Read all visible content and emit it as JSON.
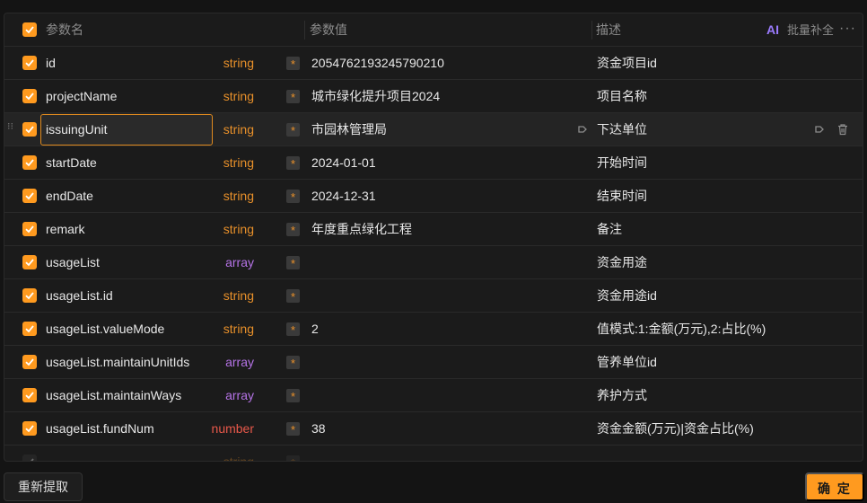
{
  "header": {
    "name_col": "参数名",
    "value_col": "参数值",
    "desc_col": "描述",
    "ai_label": "AI",
    "batch_label": "批量补全",
    "more_label": "···"
  },
  "rows": [
    {
      "name": "id",
      "type": "string",
      "required": "*",
      "value": "2054762193245790210",
      "desc": "资金项目id"
    },
    {
      "name": "projectName",
      "type": "string",
      "required": "*",
      "value": "城市绿化提升项目2024",
      "desc": "项目名称"
    },
    {
      "name": "issuingUnit",
      "type": "string",
      "required": "*",
      "value": "市园林管理局",
      "desc": "下达单位"
    },
    {
      "name": "startDate",
      "type": "string",
      "required": "*",
      "value": "2024-01-01",
      "desc": "开始时间"
    },
    {
      "name": "endDate",
      "type": "string",
      "required": "*",
      "value": "2024-12-31",
      "desc": "结束时间"
    },
    {
      "name": "remark",
      "type": "string",
      "required": "*",
      "value": "年度重点绿化工程",
      "desc": "备注"
    },
    {
      "name": "usageList",
      "type": "array",
      "required": "*",
      "value": "",
      "desc": "资金用途"
    },
    {
      "name": "usageList.id",
      "type": "string",
      "required": "*",
      "value": "",
      "desc": "资金用途id"
    },
    {
      "name": "usageList.valueMode",
      "type": "string",
      "required": "*",
      "value": "2",
      "desc": "值模式:1:金额(万元),2:占比(%)"
    },
    {
      "name": "usageList.maintainUnitIds",
      "type": "array",
      "required": "*",
      "value": "",
      "desc": "管养单位id"
    },
    {
      "name": "usageList.maintainWays",
      "type": "array",
      "required": "*",
      "value": "",
      "desc": "养护方式"
    },
    {
      "name": "usageList.fundNum",
      "type": "number",
      "required": "*",
      "value": "38",
      "desc": "资金金额(万元)|资金占比(%)"
    },
    {
      "name": "",
      "type": "string",
      "required": "*",
      "value": "",
      "desc": ""
    }
  ],
  "footer": {
    "reextract_label": "重新提取",
    "confirm_label": "确 定"
  },
  "colors": {
    "accent": "#ff9a1f",
    "type_string": "#e8902a",
    "type_array": "#b573e6",
    "type_number": "#e8584a",
    "ai": "#9b7bff"
  }
}
